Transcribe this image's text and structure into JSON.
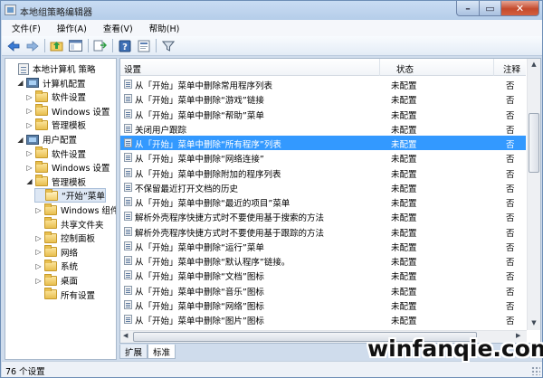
{
  "window": {
    "title": "本地组策略编辑器"
  },
  "menu": [
    "文件(F)",
    "操作(A)",
    "查看(V)",
    "帮助(H)"
  ],
  "toolbar_icons": [
    "back-icon",
    "forward-icon",
    "up-folder-icon",
    "show-hide-tree-icon",
    "export-list-icon",
    "help-icon",
    "properties-icon",
    "filter-icon"
  ],
  "tree": [
    {
      "label": "本地计算机 策略",
      "level": 0,
      "toggle": "",
      "icon": "policy"
    },
    {
      "label": "计算机配置",
      "level": 1,
      "toggle": "◢",
      "icon": "computer"
    },
    {
      "label": "软件设置",
      "level": 2,
      "toggle": "▷",
      "icon": "folder"
    },
    {
      "label": "Windows 设置",
      "level": 2,
      "toggle": "▷",
      "icon": "folder"
    },
    {
      "label": "管理模板",
      "level": 2,
      "toggle": "▷",
      "icon": "folder"
    },
    {
      "label": "用户配置",
      "level": 1,
      "toggle": "◢",
      "icon": "computer"
    },
    {
      "label": "软件设置",
      "level": 2,
      "toggle": "▷",
      "icon": "folder"
    },
    {
      "label": "Windows 设置",
      "level": 2,
      "toggle": "▷",
      "icon": "folder"
    },
    {
      "label": "管理模板",
      "level": 2,
      "toggle": "◢",
      "icon": "folder"
    },
    {
      "label": "“开始”菜单",
      "level": 3,
      "toggle": "",
      "icon": "folder-open",
      "selected": true
    },
    {
      "label": "Windows 组件",
      "level": 3,
      "toggle": "▷",
      "icon": "folder"
    },
    {
      "label": "共享文件夹",
      "level": 3,
      "toggle": "",
      "icon": "folder"
    },
    {
      "label": "控制面板",
      "level": 3,
      "toggle": "▷",
      "icon": "folder"
    },
    {
      "label": "网络",
      "level": 3,
      "toggle": "▷",
      "icon": "folder"
    },
    {
      "label": "系统",
      "level": 3,
      "toggle": "▷",
      "icon": "folder"
    },
    {
      "label": "桌面",
      "level": 3,
      "toggle": "▷",
      "icon": "folder"
    },
    {
      "label": "所有设置",
      "level": 3,
      "toggle": "",
      "icon": "folder"
    }
  ],
  "columns": {
    "setting": "设置",
    "state": "状态",
    "note": "注释"
  },
  "rows": [
    {
      "name": "从「开始」菜单中删除常用程序列表",
      "state": "未配置",
      "note": "否"
    },
    {
      "name": "从「开始」菜单中删除“游戏”链接",
      "state": "未配置",
      "note": "否"
    },
    {
      "name": "从「开始」菜单中删除“帮助”菜单",
      "state": "未配置",
      "note": "否"
    },
    {
      "name": "关闭用户跟踪",
      "state": "未配置",
      "note": "否"
    },
    {
      "name": "从「开始」菜单中删除“所有程序”列表",
      "state": "未配置",
      "note": "否",
      "selected": true
    },
    {
      "name": "从「开始」菜单中删除“网络连接”",
      "state": "未配置",
      "note": "否"
    },
    {
      "name": "从「开始」菜单中删除附加的程序列表",
      "state": "未配置",
      "note": "否"
    },
    {
      "name": "不保留最近打开文档的历史",
      "state": "未配置",
      "note": "否"
    },
    {
      "name": "从「开始」菜单中删除“最近的项目”菜单",
      "state": "未配置",
      "note": "否"
    },
    {
      "name": "解析外壳程序快捷方式时不要使用基于搜索的方法",
      "state": "未配置",
      "note": "否"
    },
    {
      "name": "解析外壳程序快捷方式时不要使用基于跟踪的方法",
      "state": "未配置",
      "note": "否"
    },
    {
      "name": "从「开始」菜单中删除“运行”菜单",
      "state": "未配置",
      "note": "否"
    },
    {
      "name": "从「开始」菜单中删除“默认程序”链接。",
      "state": "未配置",
      "note": "否"
    },
    {
      "name": "从「开始」菜单中删除“文档”图标",
      "state": "未配置",
      "note": "否"
    },
    {
      "name": "从「开始」菜单中删除“音乐”图标",
      "state": "未配置",
      "note": "否"
    },
    {
      "name": "从「开始」菜单中删除“网络”图标",
      "state": "未配置",
      "note": "否"
    },
    {
      "name": "从「开始」菜单中删除“图片”图标",
      "state": "未配置",
      "note": "否"
    }
  ],
  "tabs": [
    "扩展",
    "标准"
  ],
  "status": "76 个设置",
  "watermark": "winfanqie.com"
}
